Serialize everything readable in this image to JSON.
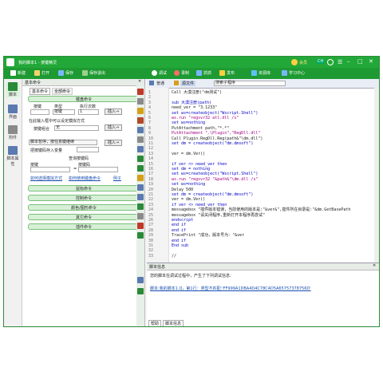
{
  "window": {
    "title": "我的脚本1 - 按键精灵",
    "vip_label": "会员",
    "lang_badge": "CH"
  },
  "toolbar": [
    {
      "label": "新建",
      "color": "#ffffff"
    },
    {
      "label": "打开",
      "color": "#f5d36b"
    },
    {
      "label": "保存",
      "color": "#7ab6ff"
    },
    {
      "label": "保存退出",
      "color": "#9ad08a"
    },
    {
      "label": "调试",
      "color": "#ffffff"
    },
    {
      "label": "录制",
      "color": "#ff6b6b"
    },
    {
      "label": "抓抓",
      "color": "#7ab6ff"
    },
    {
      "label": "发布",
      "color": "#ffcf40"
    },
    {
      "label": "资源库",
      "color": "#60c0ff"
    },
    {
      "label": "学习中心",
      "color": "#7ab6ff"
    }
  ],
  "left_strip": [
    {
      "label": "脚本",
      "color": "#2a8a3a"
    },
    {
      "label": "界面",
      "color": "#5a7ab0"
    },
    {
      "label": "附件",
      "color": "#8a8a8a"
    },
    {
      "label": "脚本属性",
      "color": "#5a7ab0"
    }
  ],
  "panel": {
    "header": "基本命令",
    "tabs": [
      "基本命令",
      "全部命令"
    ],
    "key_cmd": "键盘命令",
    "key_header": [
      "按键",
      "类型",
      "执行次数"
    ],
    "key_type_value": "按键",
    "key_count_value": "1",
    "insert": "插入→",
    "hint": "在此输入框中可以设定模拟方式",
    "combo_label": "按键组合",
    "combo_value": "无",
    "wait_label": "脚本暂停，按任意键继续",
    "save_key_label": "把按键码存入变量",
    "query_label": "查询按键码",
    "key_label": "按键",
    "keycode_label": "按键码",
    "link1": "如何选择模拟方式",
    "link2": "如何使用键盘命令",
    "link3": "例子",
    "groups": [
      "鼠标命令",
      "控制命令",
      "颜色/图形命令",
      "其它命令",
      "插件命令"
    ]
  },
  "editor": {
    "tab_normal": "普通",
    "tab_source": "源文件",
    "sub_select": "搜索子程序",
    "code_lines": [
      {
        "t": "Call 大漠注册(\"dm测试\")",
        "c": ""
      },
      {
        "t": "",
        "c": ""
      },
      {
        "t": "sub 大漠注册(path)",
        "c": "kw"
      },
      {
        "t": "need_ver = \"3.1233\"",
        "c": ""
      },
      {
        "t": "set ws=createobject(\"Wscript.Shell\")",
        "c": "kw"
      },
      {
        "t": "ws.run \"regsvr32 atl.dll /s\"",
        "c": "str"
      },
      {
        "t": "set ws=nothing",
        "c": "kw"
      },
      {
        "t": "PutAttachment path,\"*.*\"",
        "c": ""
      },
      {
        "t": "PutAttachment \".\\Plugin\",\"RegDll.dll\"",
        "c": "str"
      },
      {
        "t": "Call Plugin.RegDll.Reg(path&\"\\dm.dll\")",
        "c": ""
      },
      {
        "t": "set dm = createobject(\"dm.dmsoft\")",
        "c": "kw"
      },
      {
        "t": "",
        "c": ""
      },
      {
        "t": "ver = dm.Ver()",
        "c": ""
      },
      {
        "t": "",
        "c": ""
      },
      {
        "t": "if ver <> need_ver then",
        "c": "kw"
      },
      {
        "t": "set dm = nothing",
        "c": "kw"
      },
      {
        "t": "set ws=createobject(\"Wscript.Shell\")",
        "c": "kw"
      },
      {
        "t": "ws.run \"regsvr32 \"&path&\"\\dm.dll /s\"",
        "c": "str"
      },
      {
        "t": "set ws=nothing",
        "c": "kw"
      },
      {
        "t": "Delay 500",
        "c": ""
      },
      {
        "t": "set dm = createobject(\"dm.dmsoft\")",
        "c": "kw"
      },
      {
        "t": "ver = dm.Ver()",
        "c": ""
      },
      {
        "t": "if ver <> need_ver then",
        "c": "kw"
      },
      {
        "t": "messagebox \"插件版本错误，当前使用的版本是:\"&ver&\",插件所在目录是:\"&dm.GetBasePath",
        "c": ""
      },
      {
        "t": "messagebox \"请关闭程序,重新打开本程序再尝试\"",
        "c": ""
      },
      {
        "t": "    endscript",
        "c": "kw"
      },
      {
        "t": "  end if",
        "c": "kw"
      },
      {
        "t": "end if",
        "c": "kw"
      },
      {
        "t": "TracePrint \"成功，版本号为：\"&ver",
        "c": ""
      },
      {
        "t": "end if",
        "c": "kw"
      },
      {
        "t": "End sub",
        "c": "kw"
      },
      {
        "t": "",
        "c": ""
      },
      {
        "t": "//",
        "c": ""
      }
    ]
  },
  "info": {
    "title": "脚本信息",
    "message": "您的脚本在调试过程中，产生了下列调试信息:",
    "error": "脚本:我的脚本1.Q，第1行：类型不匹配:'FF999A1DBA4D4C78C4D5A65757378756D'",
    "bottom_tabs": [
      "帮助",
      "脚本信息"
    ]
  }
}
